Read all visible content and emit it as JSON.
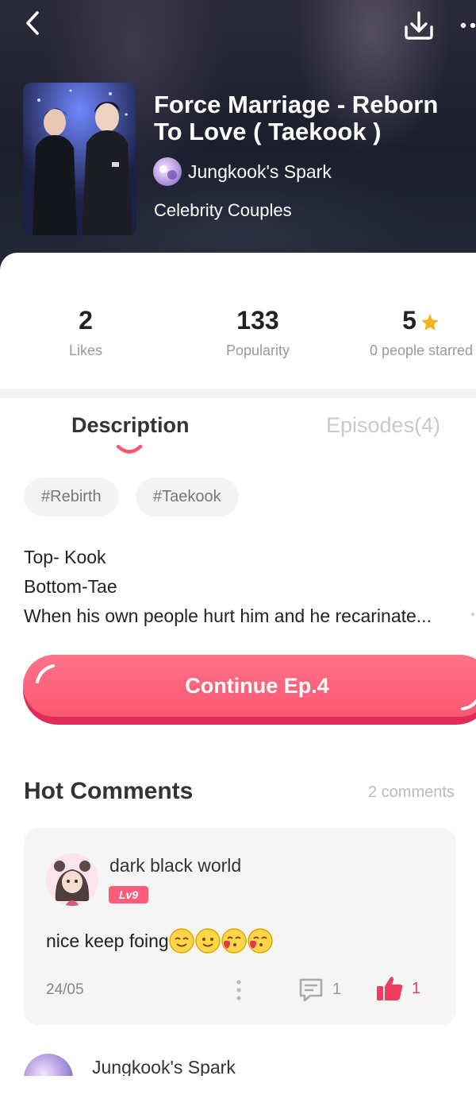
{
  "header": {
    "title": "Force Marriage - Reborn To Love ( Taekook )",
    "author": "Jungkook's Spark",
    "category": "Celebrity Couples",
    "icons": {
      "back": "back-arrow-icon",
      "download": "download-icon",
      "more": "more-dots-icon"
    }
  },
  "stats": {
    "likes": {
      "value": "2",
      "label": "Likes"
    },
    "popularity": {
      "value": "133",
      "label": "Popularity"
    },
    "rating": {
      "value": "5",
      "label": "0 people starred",
      "icon": "star-icon"
    }
  },
  "tabs": [
    {
      "label": "Description",
      "active": true
    },
    {
      "label": "Episodes(4)",
      "active": false
    }
  ],
  "tags": [
    "#Rebirth",
    "#Taekook"
  ],
  "description": {
    "lines": [
      "Top- Kook",
      "Bottom-Tae",
      "When his own people hurt him and he recarinate..."
    ]
  },
  "continue_button": {
    "label": "Continue Ep.4"
  },
  "comments": {
    "title": "Hot Comments",
    "count_label": "2 comments",
    "items": [
      {
        "user": "dark black world",
        "level": "Lv9",
        "text": "nice keep foing",
        "emojis": [
          "smile-emoji",
          "smile-emoji",
          "kiss-heart-emoji",
          "kiss-heart-emoji"
        ],
        "date": "24/05",
        "replies": "1",
        "likes": "1"
      },
      {
        "user": "Jungkook's Spark"
      }
    ]
  },
  "colors": {
    "accent": "#fb5771",
    "accent_dark": "#e02a57",
    "star": "#f5b21a",
    "muted": "#999999"
  }
}
